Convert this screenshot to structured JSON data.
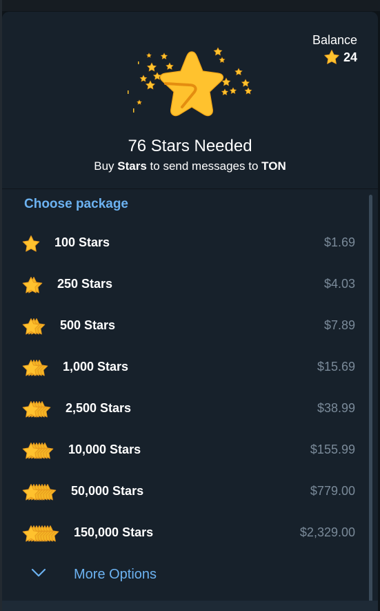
{
  "balance": {
    "label": "Balance",
    "value": "24"
  },
  "header": {
    "title": "76 Stars Needed",
    "subtitle_prefix": "Buy",
    "subtitle_stars": "Stars",
    "subtitle_middle": "to send messages to",
    "subtitle_target": "TON"
  },
  "packages": {
    "title": "Choose package",
    "items": [
      {
        "label": "100 Stars",
        "price": "$1.69",
        "icon_stack": 1
      },
      {
        "label": "250 Stars",
        "price": "$4.03",
        "icon_stack": 2
      },
      {
        "label": "500 Stars",
        "price": "$7.89",
        "icon_stack": 3
      },
      {
        "label": "1,000 Stars",
        "price": "$15.69",
        "icon_stack": 4
      },
      {
        "label": "2,500 Stars",
        "price": "$38.99",
        "icon_stack": 5
      },
      {
        "label": "10,000 Stars",
        "price": "$155.99",
        "icon_stack": 6
      },
      {
        "label": "50,000 Stars",
        "price": "$779.00",
        "icon_stack": 7
      },
      {
        "label": "150,000 Stars",
        "price": "$2,329.00",
        "icon_stack": 8
      }
    ]
  },
  "more": {
    "label": "More Options",
    "icon": "chevron-down-icon"
  },
  "colors": {
    "background": "#17212b",
    "accent": "#6cb2f1",
    "star_gold": "#ffc22e",
    "star_shadow": "#e89b1e",
    "price": "#7a8a99"
  }
}
